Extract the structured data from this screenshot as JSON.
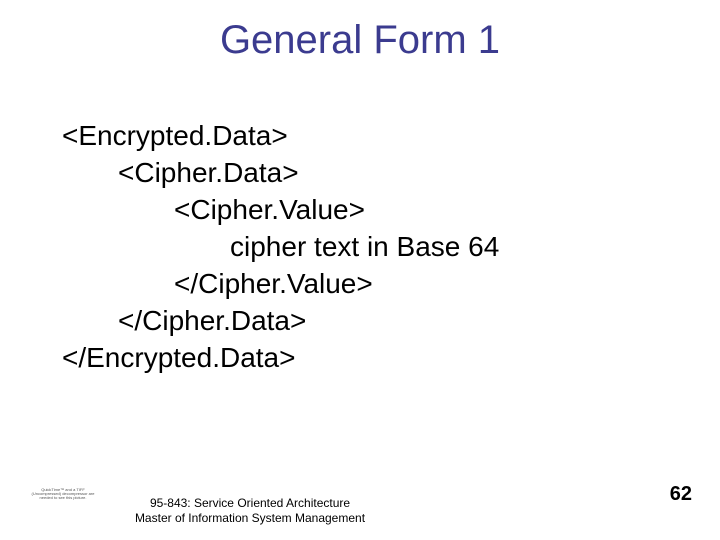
{
  "slide": {
    "title": "General Form 1",
    "lines": [
      {
        "indent": 0,
        "text": "<Encrypted.Data>"
      },
      {
        "indent": 1,
        "text": "<Cipher.Data>"
      },
      {
        "indent": 2,
        "text": "<Cipher.Value>"
      },
      {
        "indent": 3,
        "text": "cipher text in Base 64"
      },
      {
        "indent": 2,
        "text": "</Cipher.Value>"
      },
      {
        "indent": 1,
        "text": "</Cipher.Data>"
      },
      {
        "indent": 0,
        "text": "</Encrypted.Data>"
      }
    ]
  },
  "footer": {
    "course": "95-843: Service Oriented Architecture",
    "dept": "Master of Information System Management",
    "thumb": "QuickTime™ and a TIFF (Uncompressed) decompressor are needed to see this picture."
  },
  "page_number": "62"
}
